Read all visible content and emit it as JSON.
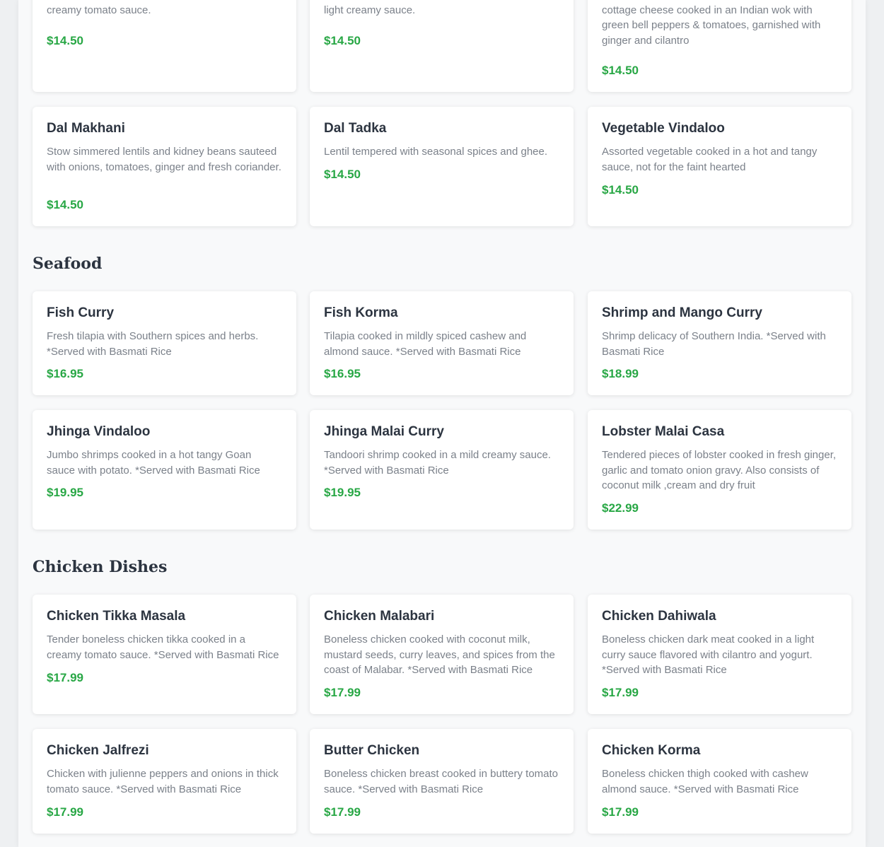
{
  "sections": [
    {
      "title": "",
      "items": [
        {
          "name": "",
          "desc": "Green peas and paneer cooked in a mildly spiced creamy tomato sauce.",
          "price": "$14.50"
        },
        {
          "name": "",
          "desc": "Grated Indian cheese, onions, bell peppers and light creamy sauce.",
          "price": "$14.50"
        },
        {
          "name": "",
          "desc": "A semidry and colourful dish of homemade cottage cheese cooked in an Indian wok with green bell peppers & tomatoes, garnished with ginger and cilantro",
          "price": "$14.50"
        },
        {
          "name": "Dal Makhani",
          "desc": "Stow simmered lentils and kidney beans sauteed with onions, tomatoes, ginger and fresh coriander.",
          "price": "$14.50"
        },
        {
          "name": "Dal Tadka",
          "desc": "Lentil tempered with seasonal spices and ghee.",
          "price": "$14.50"
        },
        {
          "name": "Vegetable Vindaloo",
          "desc": "Assorted vegetable cooked in a hot and tangy sauce, not for the faint hearted",
          "price": "$14.50"
        }
      ]
    },
    {
      "title": "Seafood",
      "items": [
        {
          "name": "Fish Curry",
          "desc": "Fresh tilapia with Southern spices and herbs. *Served with Basmati Rice",
          "price": "$16.95"
        },
        {
          "name": "Fish Korma",
          "desc": "Tilapia cooked in mildly spiced cashew and almond sauce. *Served with Basmati Rice",
          "price": "$16.95"
        },
        {
          "name": "Shrimp and Mango Curry",
          "desc": "Shrimp delicacy of Southern India. *Served with Basmati Rice",
          "price": "$18.99"
        },
        {
          "name": "Jhinga Vindaloo",
          "desc": "Jumbo shrimps cooked in a hot tangy Goan sauce with potato. *Served with Basmati Rice",
          "price": "$19.95"
        },
        {
          "name": "Jhinga Malai Curry",
          "desc": "Tandoori shrimp cooked in a mild creamy sauce. *Served with Basmati Rice",
          "price": "$19.95"
        },
        {
          "name": "Lobster Malai Casa",
          "desc": "Tendered pieces of lobster cooked in fresh ginger, garlic and tomato onion gravy. Also consists of coconut milk ,cream and dry fruit",
          "price": "$22.99"
        }
      ]
    },
    {
      "title": "Chicken Dishes",
      "items": [
        {
          "name": "Chicken Tikka Masala",
          "desc": "Tender boneless chicken tikka cooked in a creamy tomato sauce. *Served with Basmati Rice",
          "price": "$17.99"
        },
        {
          "name": "Chicken Malabari",
          "desc": "Boneless chicken cooked with coconut milk, mustard seeds, curry leaves, and spices from the coast of Malabar. *Served with Basmati Rice",
          "price": "$17.99"
        },
        {
          "name": "Chicken Dahiwala",
          "desc": "Boneless chicken dark meat cooked in a light curry sauce flavored with cilantro and yogurt. *Served with Basmati Rice",
          "price": "$17.99"
        },
        {
          "name": "Chicken Jalfrezi",
          "desc": "Chicken with julienne peppers and onions in thick tomato sauce. *Served with Basmati Rice",
          "price": "$17.99"
        },
        {
          "name": "Butter Chicken",
          "desc": "Boneless chicken breast cooked in buttery tomato sauce. *Served with Basmati Rice",
          "price": "$17.99"
        },
        {
          "name": "Chicken Korma",
          "desc": "Boneless chicken thigh cooked with cashew almond sauce. *Served with Basmati Rice",
          "price": "$17.99"
        }
      ]
    }
  ]
}
